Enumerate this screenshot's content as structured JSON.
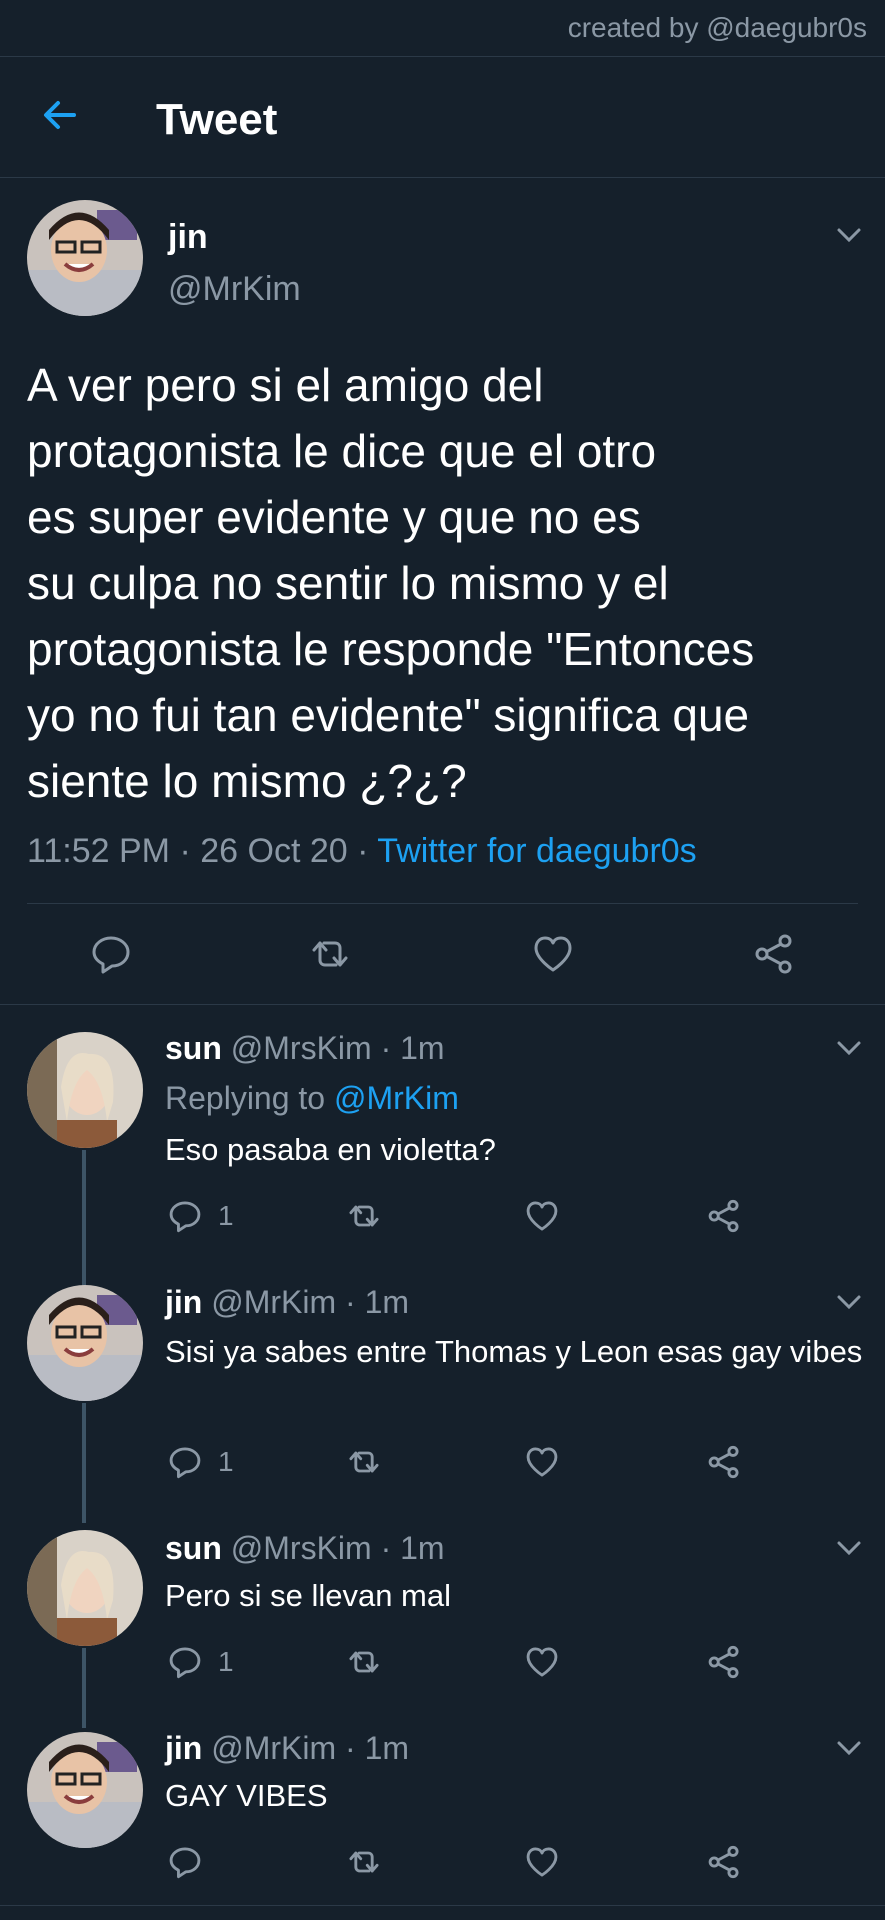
{
  "credit": "created by @daegubr0s",
  "header": {
    "title": "Tweet"
  },
  "colors": {
    "background": "#15202b",
    "accent": "#1da1f2",
    "muted": "#8b98a5",
    "divider": "#2b3947"
  },
  "tweet": {
    "name": "jin",
    "handle": "@MrKim",
    "text": "A ver pero si el amigo del\nprotagonista le dice que el otro\nes super evidente y que no es\nsu culpa no sentir lo mismo y el\nprotagonista le responde \"Entonces\nyo no fui tan evidente\" significa que\nsiente lo mismo ¿?¿?",
    "time": "11:52 PM",
    "dot1": "·",
    "date": "26 Oct 20",
    "dot2": "·",
    "source": "Twitter for daegubr0s"
  },
  "replies": [
    {
      "name": "sun",
      "handle": "@MrsKim",
      "dot": "·",
      "time": "1m",
      "replying_label": "Replying to",
      "replying_to": "@MrKim",
      "text": "Eso pasaba en violetta?",
      "reply_count": "1"
    },
    {
      "name": "jin",
      "handle": "@MrKim",
      "dot": "·",
      "time": "1m",
      "text": "Sisi ya sabes entre Thomas y Leon esas gay vibes",
      "reply_count": "1"
    },
    {
      "name": "sun",
      "handle": "@MrsKim",
      "dot": "·",
      "time": "1m",
      "text": "Pero si se llevan mal",
      "reply_count": "1"
    },
    {
      "name": "jin",
      "handle": "@MrKim",
      "dot": "·",
      "time": "1m",
      "text": "GAY VIBES",
      "reply_count": ""
    }
  ],
  "icons": [
    "back-arrow-icon",
    "chevron-down-icon",
    "reply-icon",
    "retweet-icon",
    "like-icon",
    "share-icon"
  ]
}
